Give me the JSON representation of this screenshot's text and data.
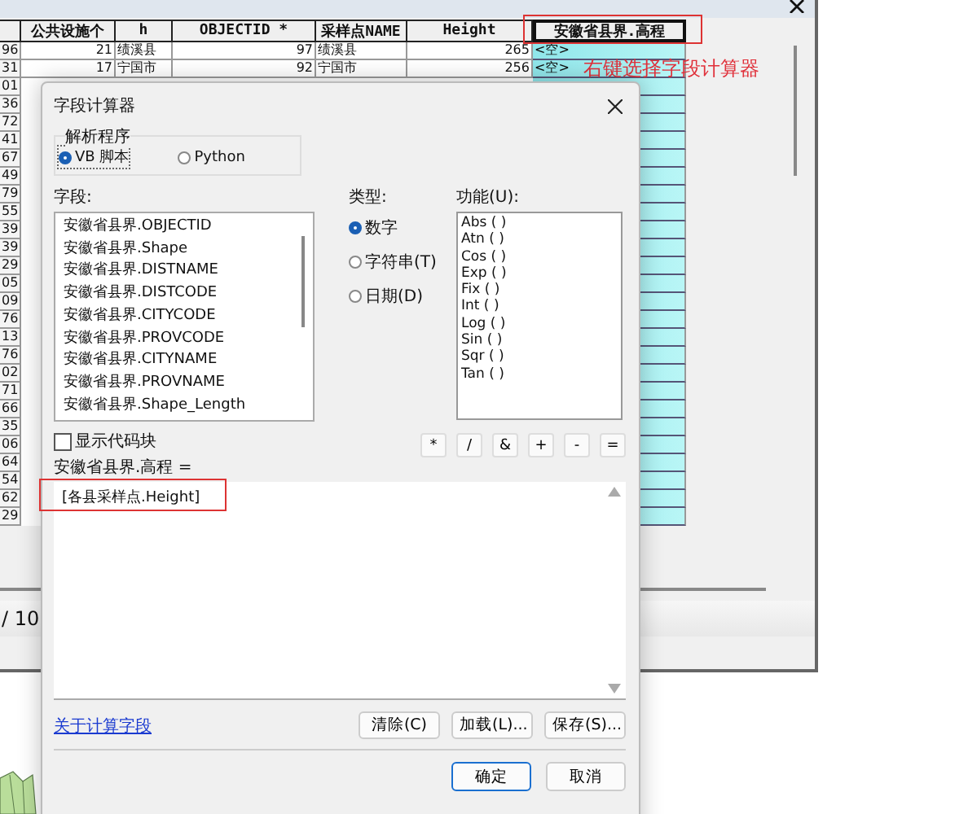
{
  "table_window": {
    "columns": [
      {
        "label": "公共设施个",
        "selected": false
      },
      {
        "label": "h",
        "selected": false
      },
      {
        "label": "OBJECTID *",
        "selected": false
      },
      {
        "label": "采样点NAME",
        "selected": false
      },
      {
        "label": "Height",
        "selected": false
      },
      {
        "label": "安徽省县界.高程",
        "selected": true
      }
    ],
    "rows": [
      {
        "stub": "96",
        "cells": [
          "21",
          "绩溪县",
          "97",
          "绩溪县",
          "265",
          "<空>"
        ]
      },
      {
        "stub": "31",
        "cells": [
          "17",
          "宁国市",
          "92",
          "宁国市",
          "256",
          "<空>"
        ]
      },
      {
        "stub": "01"
      },
      {
        "stub": "36"
      },
      {
        "stub": "72"
      },
      {
        "stub": "41"
      },
      {
        "stub": "67"
      },
      {
        "stub": "49"
      },
      {
        "stub": "79"
      },
      {
        "stub": "55"
      },
      {
        "stub": "39"
      },
      {
        "stub": "39"
      },
      {
        "stub": "29"
      },
      {
        "stub": "05"
      },
      {
        "stub": "09"
      },
      {
        "stub": "76"
      },
      {
        "stub": "13"
      },
      {
        "stub": "76"
      },
      {
        "stub": "02"
      },
      {
        "stub": "71"
      },
      {
        "stub": "66"
      },
      {
        "stub": "35"
      },
      {
        "stub": "06"
      },
      {
        "stub": "64"
      },
      {
        "stub": "54"
      },
      {
        "stub": "62"
      },
      {
        "stub": "29"
      }
    ],
    "status": "/ 10"
  },
  "annotation": {
    "text": "右键选择字段计算器"
  },
  "dialog": {
    "title": "字段计算器",
    "parser": {
      "label": "解析程序",
      "options": [
        {
          "label": "VB 脚本",
          "selected": true
        },
        {
          "label": "Python",
          "selected": false
        }
      ]
    },
    "fields": {
      "label": "字段:",
      "items": [
        "安徽省县界.OBJECTID",
        "安徽省县界.Shape",
        "安徽省县界.DISTNAME",
        "安徽省县界.DISTCODE",
        "安徽省县界.CITYCODE",
        "安徽省县界.PROVCODE",
        "安徽省县界.CITYNAME",
        "安徽省县界.PROVNAME",
        "安徽省县界.Shape_Length"
      ]
    },
    "type": {
      "label": "类型:",
      "options": [
        {
          "label": "数字",
          "selected": true
        },
        {
          "label": "字符串(T)",
          "selected": false
        },
        {
          "label": "日期(D)",
          "selected": false
        }
      ]
    },
    "functions": {
      "label": "功能(U):",
      "items": [
        "Abs ( )",
        "Atn ( )",
        "Cos ( )",
        "Exp ( )",
        "Fix ( )",
        "Int ( )",
        "Log ( )",
        "Sin ( )",
        "Sqr ( )",
        "Tan ( )"
      ]
    },
    "show_codeblock": {
      "label": "显示代码块",
      "checked": false
    },
    "operators": [
      "*",
      "/",
      "&",
      "+",
      "-",
      "="
    ],
    "expression_label": "安徽省县界.高程 =",
    "expression": "[各县采样点.Height]",
    "help_link": "关于计算字段",
    "file_buttons": [
      "清除(C)",
      "加载(L)...",
      "保存(S)..."
    ],
    "buttons": [
      {
        "label": "确定",
        "default": true
      },
      {
        "label": "取消",
        "default": false
      }
    ]
  }
}
